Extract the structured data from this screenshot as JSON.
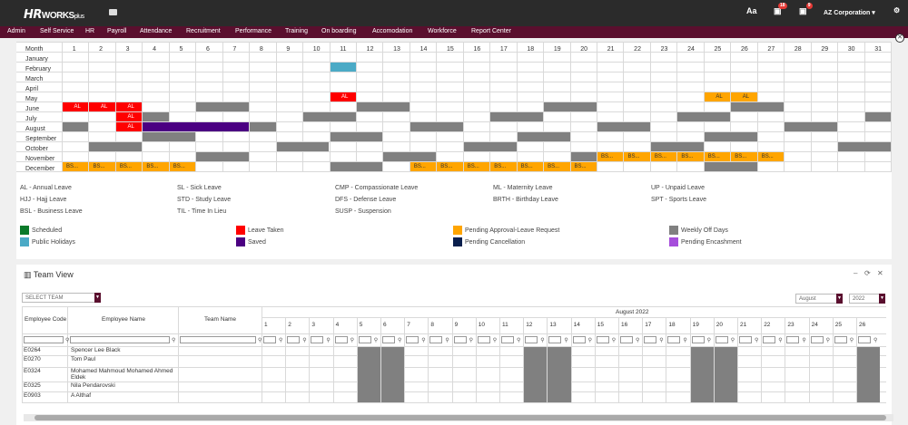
{
  "topbar": {
    "logo_hr": "HR",
    "logo_works": "WORKS",
    "logo_plus": "plus",
    "font_icon": "Aa",
    "notif_badge_1": "18",
    "notif_badge_2": "9",
    "company": "AZ Corporation ▾",
    "icons": [
      "folder-icon",
      "font-size-icon",
      "bell-icon",
      "calendar-icon",
      "settings-icon"
    ]
  },
  "menu": [
    "Admin",
    "Self Service",
    "HR",
    "Payroll",
    "Attendance",
    "Recruitment",
    "Performance",
    "Training",
    "On boarding",
    "Accomodation",
    "Workforce",
    "Report Center"
  ],
  "calendar": {
    "month_header": "Month",
    "days": [
      "1",
      "2",
      "3",
      "4",
      "5",
      "6",
      "7",
      "8",
      "9",
      "10",
      "11",
      "12",
      "13",
      "14",
      "15",
      "16",
      "17",
      "18",
      "19",
      "20",
      "21",
      "22",
      "23",
      "24",
      "25",
      "26",
      "27",
      "28",
      "29",
      "30",
      "31"
    ],
    "months": [
      "January",
      "February",
      "March",
      "April",
      "May",
      "June",
      "July",
      "August",
      "September",
      "October",
      "November",
      "December"
    ],
    "colors": {
      "gray": "#808080",
      "red": "#ff0000",
      "orange": "#ffa500",
      "teal": "#4baac6",
      "purple": "#4b0082",
      "green": "#0a7a2a",
      "navy": "#0a1f4d",
      "violet": "#a64ddb"
    },
    "cells": [
      {
        "month": 1,
        "from": 11,
        "to": 11,
        "color": "teal",
        "text": ""
      },
      {
        "month": 4,
        "from": 11,
        "to": 11,
        "color": "red",
        "text": "AL"
      },
      {
        "month": 4,
        "from": 25,
        "to": 25,
        "color": "orange",
        "text": "AL"
      },
      {
        "month": 4,
        "from": 26,
        "to": 26,
        "color": "orange",
        "text": "AL"
      },
      {
        "month": 5,
        "from": 1,
        "to": 1,
        "color": "red",
        "text": "AL"
      },
      {
        "month": 5,
        "from": 2,
        "to": 2,
        "color": "red",
        "text": "AL"
      },
      {
        "month": 5,
        "from": 3,
        "to": 3,
        "color": "red",
        "text": "AL"
      },
      {
        "month": 5,
        "from": 6,
        "to": 7,
        "color": "gray",
        "text": ""
      },
      {
        "month": 5,
        "from": 12,
        "to": 13,
        "color": "gray",
        "text": ""
      },
      {
        "month": 5,
        "from": 19,
        "to": 20,
        "color": "gray",
        "text": ""
      },
      {
        "month": 5,
        "from": 26,
        "to": 27,
        "color": "gray",
        "text": ""
      },
      {
        "month": 6,
        "from": 3,
        "to": 3,
        "color": "red",
        "text": "AL"
      },
      {
        "month": 6,
        "from": 4,
        "to": 4,
        "color": "gray",
        "text": ""
      },
      {
        "month": 6,
        "from": 10,
        "to": 11,
        "color": "gray",
        "text": ""
      },
      {
        "month": 6,
        "from": 17,
        "to": 18,
        "color": "gray",
        "text": ""
      },
      {
        "month": 6,
        "from": 24,
        "to": 25,
        "color": "gray",
        "text": ""
      },
      {
        "month": 6,
        "from": 31,
        "to": 31,
        "color": "gray",
        "text": ""
      },
      {
        "month": 7,
        "from": 1,
        "to": 1,
        "color": "gray",
        "text": ""
      },
      {
        "month": 7,
        "from": 3,
        "to": 3,
        "color": "red",
        "text": "AL"
      },
      {
        "month": 7,
        "from": 4,
        "to": 7,
        "color": "purple",
        "text": ""
      },
      {
        "month": 7,
        "from": 8,
        "to": 8,
        "color": "gray",
        "text": ""
      },
      {
        "month": 7,
        "from": 14,
        "to": 15,
        "color": "gray",
        "text": ""
      },
      {
        "month": 7,
        "from": 21,
        "to": 22,
        "color": "gray",
        "text": ""
      },
      {
        "month": 7,
        "from": 28,
        "to": 29,
        "color": "gray",
        "text": ""
      },
      {
        "month": 8,
        "from": 4,
        "to": 5,
        "color": "gray",
        "text": ""
      },
      {
        "month": 8,
        "from": 11,
        "to": 12,
        "color": "gray",
        "text": ""
      },
      {
        "month": 8,
        "from": 18,
        "to": 19,
        "color": "gray",
        "text": ""
      },
      {
        "month": 8,
        "from": 25,
        "to": 26,
        "color": "gray",
        "text": ""
      },
      {
        "month": 9,
        "from": 2,
        "to": 3,
        "color": "gray",
        "text": ""
      },
      {
        "month": 9,
        "from": 9,
        "to": 10,
        "color": "gray",
        "text": ""
      },
      {
        "month": 9,
        "from": 16,
        "to": 17,
        "color": "gray",
        "text": ""
      },
      {
        "month": 9,
        "from": 23,
        "to": 24,
        "color": "gray",
        "text": ""
      },
      {
        "month": 9,
        "from": 30,
        "to": 31,
        "color": "gray",
        "text": ""
      },
      {
        "month": 10,
        "from": 6,
        "to": 7,
        "color": "gray",
        "text": ""
      },
      {
        "month": 10,
        "from": 13,
        "to": 14,
        "color": "gray",
        "text": ""
      },
      {
        "month": 10,
        "from": 20,
        "to": 20,
        "color": "gray",
        "text": ""
      },
      {
        "month": 10,
        "from": 21,
        "to": 21,
        "color": "orange",
        "text": "BS..."
      },
      {
        "month": 10,
        "from": 22,
        "to": 22,
        "color": "orange",
        "text": "BS..."
      },
      {
        "month": 10,
        "from": 23,
        "to": 23,
        "color": "orange",
        "text": "BS..."
      },
      {
        "month": 10,
        "from": 24,
        "to": 24,
        "color": "orange",
        "text": "BS..."
      },
      {
        "month": 10,
        "from": 25,
        "to": 25,
        "color": "orange",
        "text": "BS..."
      },
      {
        "month": 10,
        "from": 26,
        "to": 26,
        "color": "orange",
        "text": "BS..."
      },
      {
        "month": 10,
        "from": 27,
        "to": 27,
        "color": "orange",
        "text": "BS..."
      },
      {
        "month": 11,
        "from": 1,
        "to": 1,
        "color": "orange",
        "text": "BS..."
      },
      {
        "month": 11,
        "from": 2,
        "to": 2,
        "color": "orange",
        "text": "BS..."
      },
      {
        "month": 11,
        "from": 3,
        "to": 3,
        "color": "orange",
        "text": "BS..."
      },
      {
        "month": 11,
        "from": 4,
        "to": 4,
        "color": "orange",
        "text": "BS..."
      },
      {
        "month": 11,
        "from": 5,
        "to": 5,
        "color": "orange",
        "text": "BS..."
      },
      {
        "month": 11,
        "from": 11,
        "to": 12,
        "color": "gray",
        "text": ""
      },
      {
        "month": 11,
        "from": 14,
        "to": 14,
        "color": "orange",
        "text": "BS..."
      },
      {
        "month": 11,
        "from": 15,
        "to": 15,
        "color": "orange",
        "text": "BS..."
      },
      {
        "month": 11,
        "from": 16,
        "to": 16,
        "color": "orange",
        "text": "BS..."
      },
      {
        "month": 11,
        "from": 17,
        "to": 17,
        "color": "orange",
        "text": "BS..."
      },
      {
        "month": 11,
        "from": 18,
        "to": 18,
        "color": "orange",
        "text": "BS..."
      },
      {
        "month": 11,
        "from": 19,
        "to": 19,
        "color": "orange",
        "text": "BS..."
      },
      {
        "month": 11,
        "from": 20,
        "to": 20,
        "color": "orange",
        "text": "BS..."
      },
      {
        "month": 11,
        "from": 25,
        "to": 26,
        "color": "gray",
        "text": ""
      }
    ],
    "leave_types": [
      [
        "AL - Annual Leave",
        "SL - Sick Leave",
        "CMP - Compassionate Leave",
        "ML - Maternity Leave",
        "UP - Unpaid Leave"
      ],
      [
        "HJJ - Hajj Leave",
        "STD - Study Leave",
        "DFS - Defense Leave",
        "BRTH - Birthday Leave",
        "SPT - Sports Leave"
      ],
      [
        "BSL - Business Leave",
        "TIL - Time In Lieu",
        "SUSP - Suspension",
        "",
        ""
      ]
    ],
    "legend": [
      {
        "label": "Scheduled",
        "color": "green"
      },
      {
        "label": "Leave Taken",
        "color": "red"
      },
      {
        "label": "Pending Approval-Leave Request",
        "color": "orange"
      },
      {
        "label": "Weekly Off Days",
        "color": "gray"
      },
      {
        "label": "Public Holidays",
        "color": "teal"
      },
      {
        "label": "Saved",
        "color": "purple"
      },
      {
        "label": "Pending Cancellation",
        "color": "navy"
      },
      {
        "label": "Pending Encashment",
        "color": "violet"
      }
    ]
  },
  "team": {
    "title": "Team View",
    "controls": [
      "–",
      "⟳",
      "✕"
    ],
    "select_team": "SELECT TEAM",
    "month_select": "August",
    "year_select": "2022",
    "month_caption": "August 2022",
    "col_code": "Employee Code",
    "col_name": "Employee Name",
    "col_team": "Team Name",
    "days": [
      "1",
      "2",
      "3",
      "4",
      "5",
      "6",
      "7",
      "8",
      "9",
      "10",
      "11",
      "12",
      "13",
      "14",
      "15",
      "16",
      "17",
      "18",
      "19",
      "20",
      "21",
      "22",
      "23",
      "24",
      "25",
      "26"
    ],
    "off_days": [
      5,
      6,
      12,
      13,
      19,
      20,
      26
    ],
    "employees": [
      {
        "code": "E0264",
        "name": "Spencer Lee Black",
        "name2": ""
      },
      {
        "code": "E0270",
        "name": "Tom Paul",
        "name2": ""
      },
      {
        "code": "E0324",
        "name": "Mohamed Mahmoud Mohamed Ahmed",
        "name2": "Eldek"
      },
      {
        "code": "E0325",
        "name": "Nila Pendarovski",
        "name2": ""
      },
      {
        "code": "E0903",
        "name": "A Althaf",
        "name2": ""
      }
    ]
  }
}
